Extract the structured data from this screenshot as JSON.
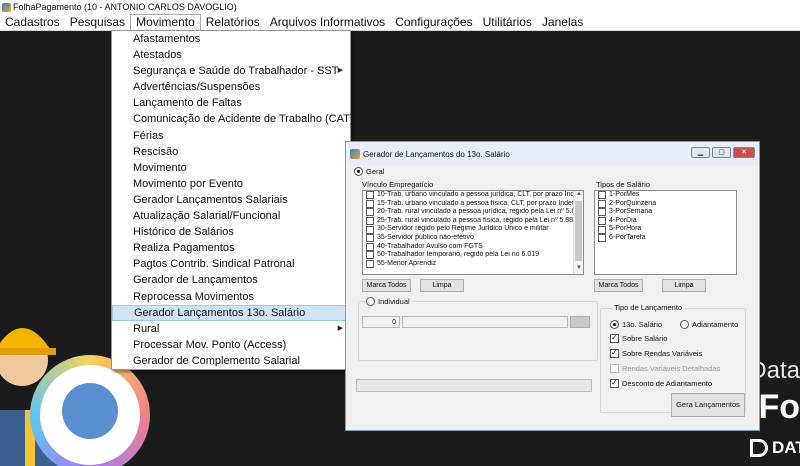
{
  "window": {
    "title": "FolhaPagamento (10 - ANTONIO CARLOS DAVOGLIO)"
  },
  "menubar": [
    "Cadastros",
    "Pesquisas",
    "Movimento",
    "Relatórios",
    "Arquivos Informativos",
    "Configurações",
    "Utilitários",
    "Janelas"
  ],
  "menubar_active": "Movimento",
  "dropdown": [
    {
      "label": "Afastamentos"
    },
    {
      "label": "Atestados"
    },
    {
      "label": "Segurança e Saúde do Trabalhador - SST",
      "submenu": true
    },
    {
      "label": "Advertências/Suspensões"
    },
    {
      "label": "Lançamento de Faltas"
    },
    {
      "label": "Comunicação de Acidente de Trabalho (CAT)"
    },
    {
      "label": "Férias"
    },
    {
      "label": "Rescisão"
    },
    {
      "label": "Movimento"
    },
    {
      "label": "Movimento por Evento"
    },
    {
      "label": "Gerador Lançamentos Salariais"
    },
    {
      "label": "Atualização Salarial/Funcional"
    },
    {
      "label": "Histórico de Salários"
    },
    {
      "label": "Realiza Pagamentos"
    },
    {
      "label": "Pagtos Contrib. Sindical Patronal"
    },
    {
      "label": "Gerador de Lançamentos"
    },
    {
      "label": "Reprocessa Movimentos"
    },
    {
      "label": "Gerador Lançamentos 13o. Salário",
      "highlighted": true
    },
    {
      "label": "Rural",
      "submenu": true
    },
    {
      "label": "Processar Mov. Ponto (Access)"
    },
    {
      "label": "Gerador de Complemento Salarial"
    }
  ],
  "dialog": {
    "title": "Gerador de Lançamentos do 13o. Salário",
    "geral_label": "Geral",
    "vinculo_label": "Vínculo Empregatício",
    "vinculos": [
      "10-Trab. urbano vinculado a pessoa jurídica, CLT, por prazo Indeter",
      "15-Trab. urbano vinculado a pessoa física, CLT, por prazo Indeterm",
      "20-Trab. rural vinculado a pessoa jurídica, regido pela Lei nº 5.889/",
      "25-Trab. rural vinculado a pessoa física, regido pela Lei nº 5.889/73",
      "30-Servidor regido pelo Regime Jurídico Único e militar",
      "35-Servidor público não-efetivo",
      "40-Trabalhador Avulso com FGTS",
      "50-Trabalhador temporário, regido pela Lei no 6.019",
      "55-Menor Aprendiz"
    ],
    "tipos_label": "Tipos de Salário",
    "tipos": [
      "1-PorMes",
      "2-PorQuinzena",
      "3-PorSemana",
      "4-PorDia",
      "5-PorHora",
      "6-PorTarefa"
    ],
    "marca_todos": "Marca Todos",
    "limpa": "Limpa",
    "individual_label": "Individual",
    "individual_value": "0",
    "tipo_lancamento_label": "Tipo de Lançamento",
    "opt_13": "13o. Salário",
    "opt_adiant": "Adiantamento",
    "sobre_salario": "Sobre Salário",
    "sobre_rendas": "Sobre Rendas Variáveis",
    "rendas_detalhadas": "Rendas Variáveis Detalhadas",
    "desconto_adiant": "Desconto de Adiantamento",
    "gera_btn": "Gera Lançamentos"
  },
  "brand": {
    "line1": "Data",
    "line2": "Fo",
    "line3": "DAT"
  },
  "colors": {
    "highlight": "#cde4f7",
    "background": "#1b1b1b"
  }
}
